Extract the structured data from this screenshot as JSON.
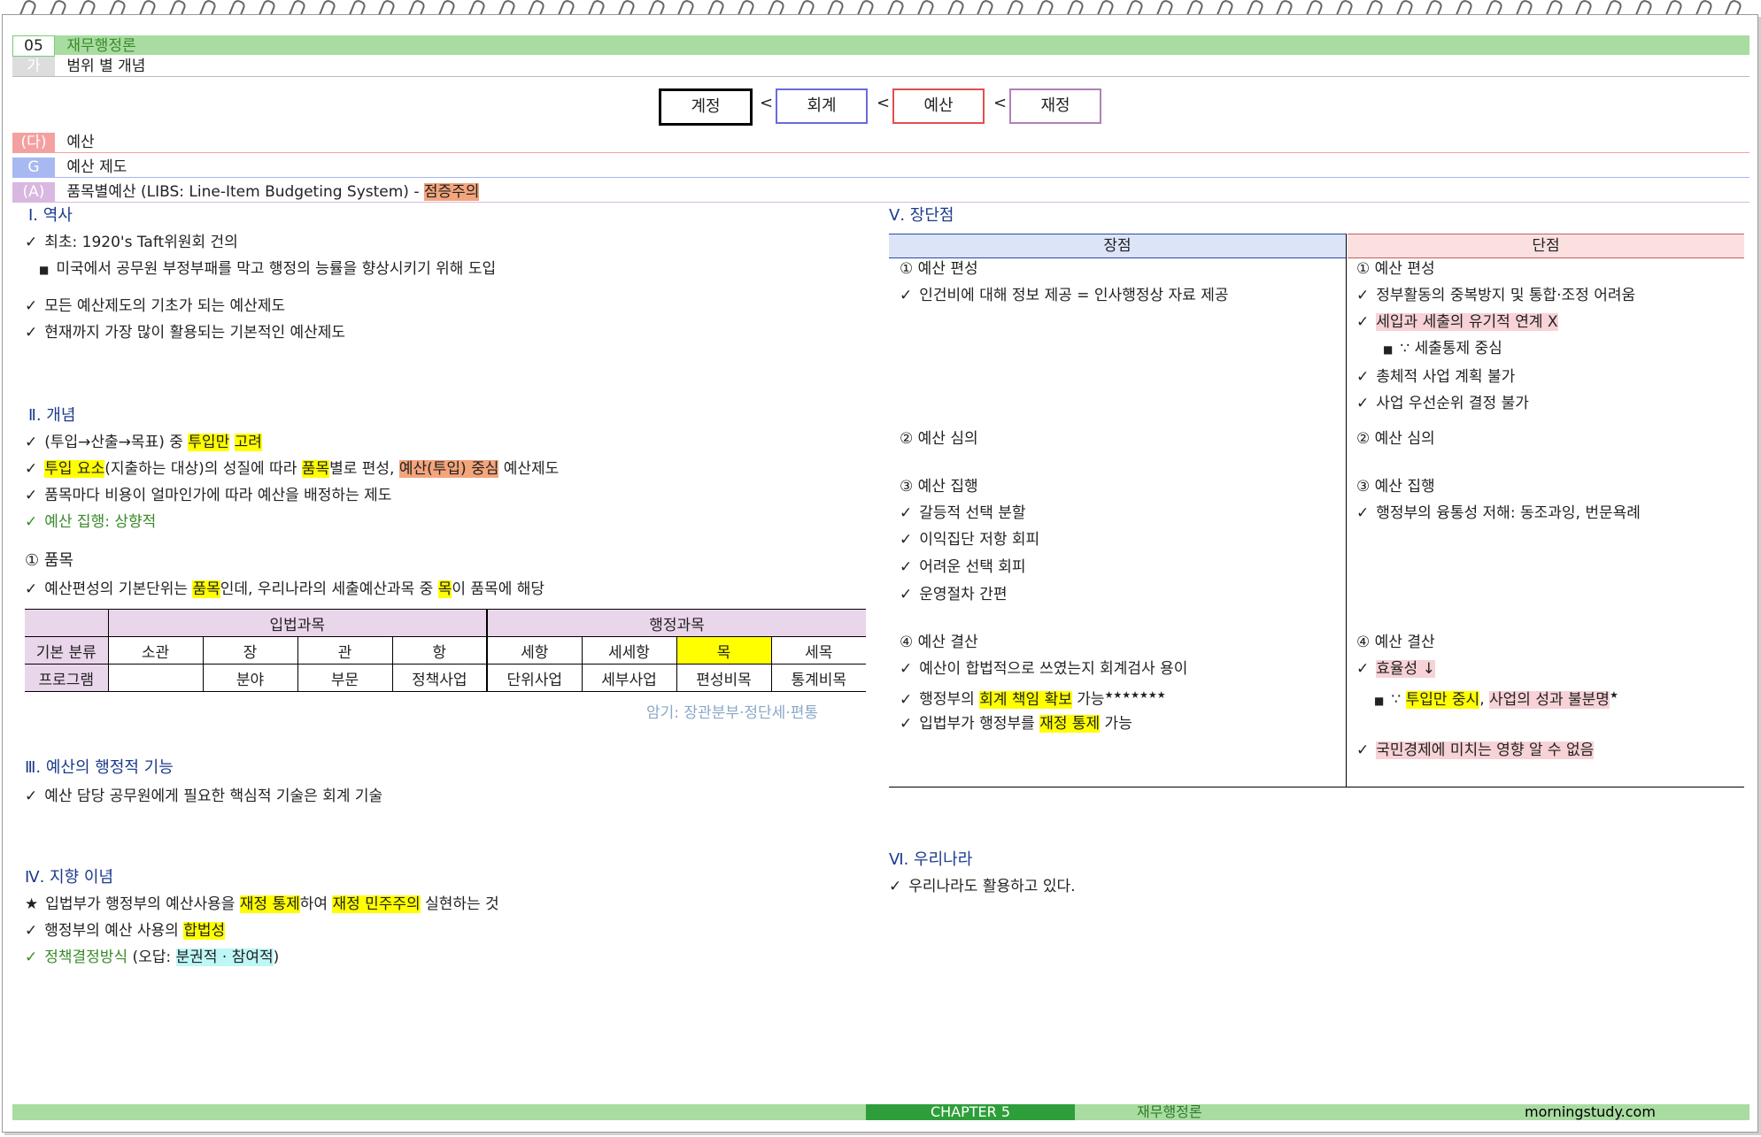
{
  "header": {
    "chapter_no": "05",
    "chapter_title": "재무행정론",
    "sub_tag": "가",
    "sub_title": "범위 별 개념"
  },
  "concept_boxes": [
    "계정",
    "회계",
    "예산",
    "재정"
  ],
  "concept_sep": "<",
  "sections": {
    "da": {
      "tag": "(다)",
      "title": "예산"
    },
    "g": {
      "tag": "G",
      "title": "예산 제도"
    },
    "a": {
      "tag": "(A)",
      "title": "품목별예산 (LIBS: Line-Item Budgeting System) - ",
      "badge": "점증주의"
    }
  },
  "left": {
    "history": {
      "title": "Ⅰ. 역사",
      "l1": "최초: 1920's Taft위원회 건의",
      "l2": "미국에서 공무원 부정부패를 막고 행정의 능률을 향상시키기 위해 도입",
      "l3": "모든 예산제도의 기초가 되는 예산제도",
      "l4": "현재까지 가장 많이 활용되는 기본적인 예산제도"
    },
    "concept": {
      "title": "Ⅱ. 개념",
      "c1a": "(투입→산출→목표) 중 ",
      "c1b": "투입만",
      "c1c": " ",
      "c1d": "고려",
      "c2a": "투입 요소",
      "c2b": "(지출하는 대상)의 성질에 따라 ",
      "c2c": "품목",
      "c2d": "별로 편성, ",
      "c2e": "예산(투입) 중심",
      "c2f": " 예산제도",
      "c3": "품목마다 비용이 얼마인가에 따라 예산을 배정하는 제도",
      "c4": "예산 집행: 상향적"
    },
    "item": {
      "title": "① 품목",
      "i1a": "예산편성의 기본단위는 ",
      "i1b": "품목",
      "i1c": "인데, 우리나라의 세출예산과목 중 ",
      "i1d": "목",
      "i1e": "이 품목에 해당"
    },
    "table": {
      "h_legis": "입법과목",
      "h_admin": "행정과목",
      "r1_head": "기본 분류",
      "r1": [
        "소관",
        "장",
        "관",
        "항",
        "세항",
        "세세항",
        "목",
        "세목"
      ],
      "r2_head": "프로그램",
      "r2": [
        "",
        "분야",
        "부문",
        "정책사업",
        "단위사업",
        "세부사업",
        "편성비목",
        "통계비목"
      ]
    },
    "memo": "암기: 장관분부·정단세·편통",
    "admin_function": {
      "title": "Ⅲ. 예산의 행정적 기능",
      "l1": "예산 담당 공무원에게 필요한 핵심적 기술은 회계 기술"
    },
    "ideology": {
      "title": "Ⅳ. 지향 이념",
      "s1a": "입법부가 행정부의 예산사용을 ",
      "s1b": "재정 통제",
      "s1c": "하여 ",
      "s1d": "재정 민주주의",
      "s1e": " 실현하는 것",
      "s2a": "행정부의 예산 사용의 ",
      "s2b": "합법성",
      "s3a": "정책결정방식",
      "s3b": " (오답: ",
      "s3c": "분권적 · 참여적",
      "s3d": ")"
    }
  },
  "right": {
    "pros_cons": {
      "title": "Ⅴ. 장단점",
      "col_pro": "장점",
      "col_con": "단점",
      "p_budget": "① 예산 편성",
      "p_b1": "인건비에 대해 정보 제공 = 인사행정상 자료 제공",
      "c_budget": "① 예산 편성",
      "c_b1": "정부활동의 중복방지 및 통합·조정 어려움",
      "c_b2": "세입과 세출의 유기적 연계 X",
      "c_b3": "∵ 세출통제 중심",
      "c_b4": "총체적 사업 계획 불가",
      "c_b5": "사업 우선순위 결정 불가",
      "p_review": "② 예산 심의",
      "c_review": "② 예산 심의",
      "p_exec": "③ 예산 집행",
      "p_e1": "갈등적 선택 분할",
      "p_e2": "이익집단 저항 회피",
      "p_e3": "어려운 선택 회피",
      "p_e4": "운영절차 간편",
      "c_exec": "③ 예산 집행",
      "c_e1": "행정부의 융통성 저해: 동조과잉, 번문욕례",
      "p_settle": "④ 예산 결산",
      "p_s1": "예산이 합법적으로 쓰였는지 회계검사 용이",
      "p_s2a": "행정부의 ",
      "p_s2b": "회계 책임 확보",
      "p_s2c": " 가능",
      "p_s2d": "★★★★★★★",
      "p_s3a": "입법부가 행정부를 ",
      "p_s3b": "재정 통제",
      "p_s3c": " 가능",
      "c_settle": "④ 예산 결산",
      "c_s1a": "효율성 ↓",
      "c_s2a": "∵ ",
      "c_s2b": "투입만 중시",
      "c_s2c": ", ",
      "c_s2d": "사업의 성과 불분명",
      "c_s2e": "★",
      "c_s3": "국민경제에 미치는 영향 알 수 없음"
    },
    "korea": {
      "title": "Ⅵ. 우리나라",
      "l1": "우리나라도 활용하고 있다."
    }
  },
  "footer": {
    "chapter": "CHAPTER 5",
    "title": "재무행정론",
    "site": "morningstudy.com"
  },
  "colors": {
    "green_bar": "#a8dca0",
    "dark_green": "#2e9e3a",
    "pink_bar": "#f4a0a0",
    "blue_bar": "#a8b8f0",
    "purple_bar": "#d8b8e0",
    "table_head": "#ead6ea",
    "highlight": "#ffff00"
  }
}
